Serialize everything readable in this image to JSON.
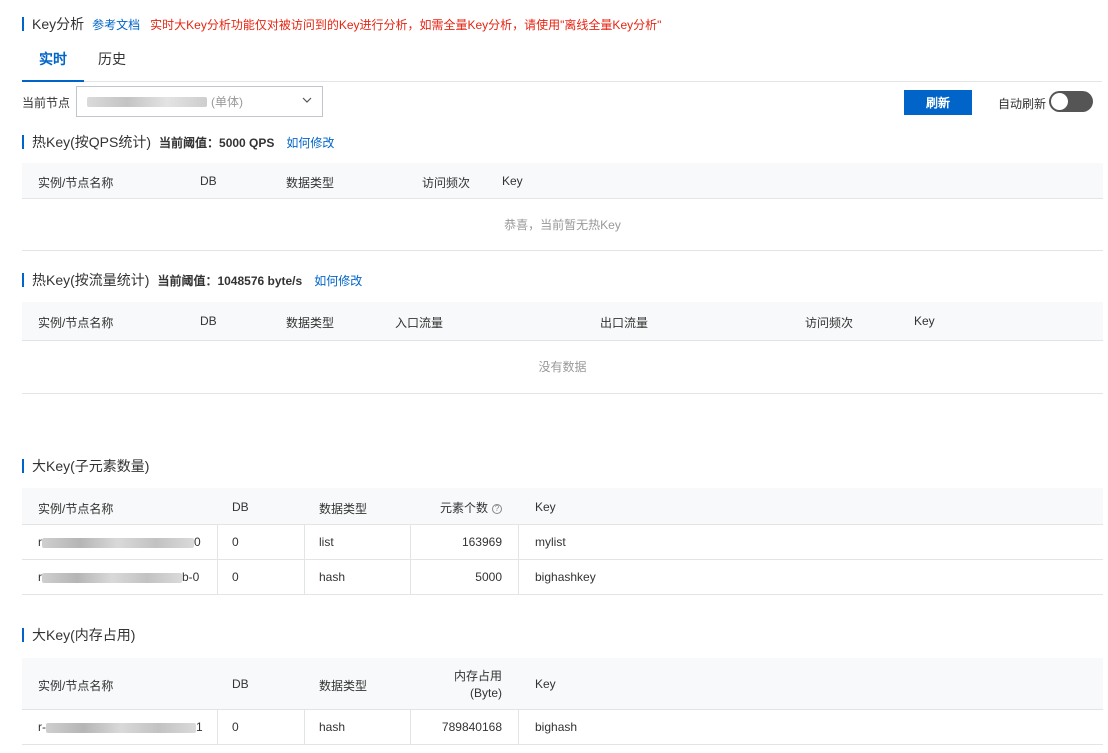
{
  "header": {
    "title": "Key分析",
    "doc_link": "参考文档",
    "warning": "实时大Key分析功能仅对被访问到的Key进行分析，如需全量Key分析，请使用\"离线全量Key分析\""
  },
  "tabs": [
    {
      "label": "实时",
      "active": true
    },
    {
      "label": "历史",
      "active": false
    }
  ],
  "toolbar": {
    "node_label": "当前节点",
    "node_value_suffix": "(单体)",
    "refresh_label": "刷新",
    "auto_refresh_label": "自动刷新",
    "auto_refresh_on": false
  },
  "hot_qps": {
    "title": "热Key(按QPS统计)",
    "threshold": "当前阈值：5000 QPS",
    "how_link": "如何修改",
    "columns": [
      "实例/节点名称",
      "DB",
      "数据类型",
      "访问频次",
      "Key"
    ],
    "empty_text": "恭喜，当前暂无热Key"
  },
  "hot_traffic": {
    "title": "热Key(按流量统计)",
    "threshold": "当前阈值：1048576 byte/s",
    "how_link": "如何修改",
    "columns": [
      "实例/节点名称",
      "DB",
      "数据类型",
      "入口流量",
      "出口流量",
      "访问频次",
      "Key"
    ],
    "empty_text": "没有数据"
  },
  "big_elements": {
    "title": "大Key(子元素数量)",
    "columns": [
      "实例/节点名称",
      "DB",
      "数据类型",
      "元素个数",
      "Key"
    ],
    "help_icon": "question-circle-icon",
    "rows": [
      {
        "node_prefix": "r",
        "node_suffix": "0",
        "db": "0",
        "type": "list",
        "count": "163969",
        "key": "mylist"
      },
      {
        "node_prefix": "r",
        "node_suffix": "b-0",
        "db": "0",
        "type": "hash",
        "count": "5000",
        "key": "bighashkey"
      }
    ]
  },
  "big_memory": {
    "title": "大Key(内存占用)",
    "columns": [
      "实例/节点名称",
      "DB",
      "数据类型",
      "内存占用",
      "(Byte)",
      "Key"
    ],
    "rows": [
      {
        "node_prefix": "r-",
        "node_suffix": "1",
        "db": "0",
        "type": "hash",
        "memory": "789840168",
        "key": "bighash"
      }
    ]
  },
  "colors": {
    "accent": "#0064c8",
    "warning": "#e62412",
    "header_bg": "#f7f9fa"
  }
}
